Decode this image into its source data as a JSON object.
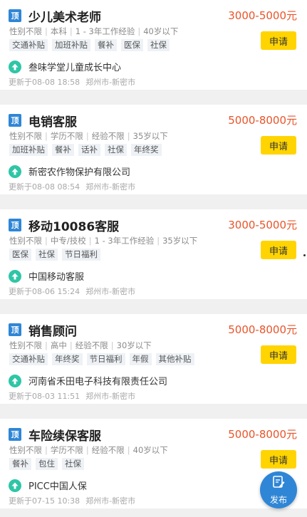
{
  "badge_label": "顶",
  "apply_label": "申请",
  "publish_label": "发布",
  "colors": {
    "salary": "#e8542a",
    "apply_button": "#ffd400",
    "badge": "#2f86d6",
    "company_icon": "#2ec6a6",
    "publish_button": "#2f86d6"
  },
  "icons": {
    "badge": "top-badge",
    "company": "arrow-up-icon",
    "publish": "edit-icon"
  },
  "jobs": [
    {
      "title": "少儿美术老师",
      "salary": "3000-5000元",
      "requirements": [
        "性别不限",
        "本科",
        "1 - 3年工作经验",
        "40岁以下"
      ],
      "tags": [
        "交通补贴",
        "加班补贴",
        "餐补",
        "医保",
        "社保"
      ],
      "company": "叁味学堂儿童成长中心",
      "updated": "更新于08-08 18:58",
      "location": "郑州市-新密市"
    },
    {
      "title": "电销客服",
      "salary": "5000-8000元",
      "requirements": [
        "性别不限",
        "学历不限",
        "经验不限",
        "35岁以下"
      ],
      "tags": [
        "加班补贴",
        "餐补",
        "话补",
        "社保",
        "年终奖"
      ],
      "company": "新密农作物保护有限公司",
      "updated": "更新于08-08 08:54",
      "location": "郑州市-新密市"
    },
    {
      "title": "移动10086客服",
      "salary": "3000-5000元",
      "requirements": [
        "性别不限",
        "中专/技校",
        "1 - 3年工作经验",
        "35岁以下"
      ],
      "tags": [
        "医保",
        "社保",
        "节日福利"
      ],
      "company": "中国移动客服",
      "updated": "更新于08-06 15:24",
      "location": "郑州市-新密市"
    },
    {
      "title": "销售顾问",
      "salary": "5000-8000元",
      "requirements": [
        "性别不限",
        "高中",
        "经验不限",
        "30岁以下"
      ],
      "tags": [
        "交通补贴",
        "年终奖",
        "节日福利",
        "年假",
        "其他补贴"
      ],
      "company": "河南省禾田电子科技有限责任公司",
      "updated": "更新于08-03 11:51",
      "location": "郑州市-新密市"
    },
    {
      "title": "车险续保客服",
      "salary": "5000-8000元",
      "requirements": [
        "性别不限",
        "学历不限",
        "经验不限",
        "40岁以下"
      ],
      "tags": [
        "餐补",
        "包住",
        "社保"
      ],
      "company": "PICC中国人保",
      "updated": "更新于07-15 10:38",
      "location": "郑州市-新密市"
    }
  ]
}
